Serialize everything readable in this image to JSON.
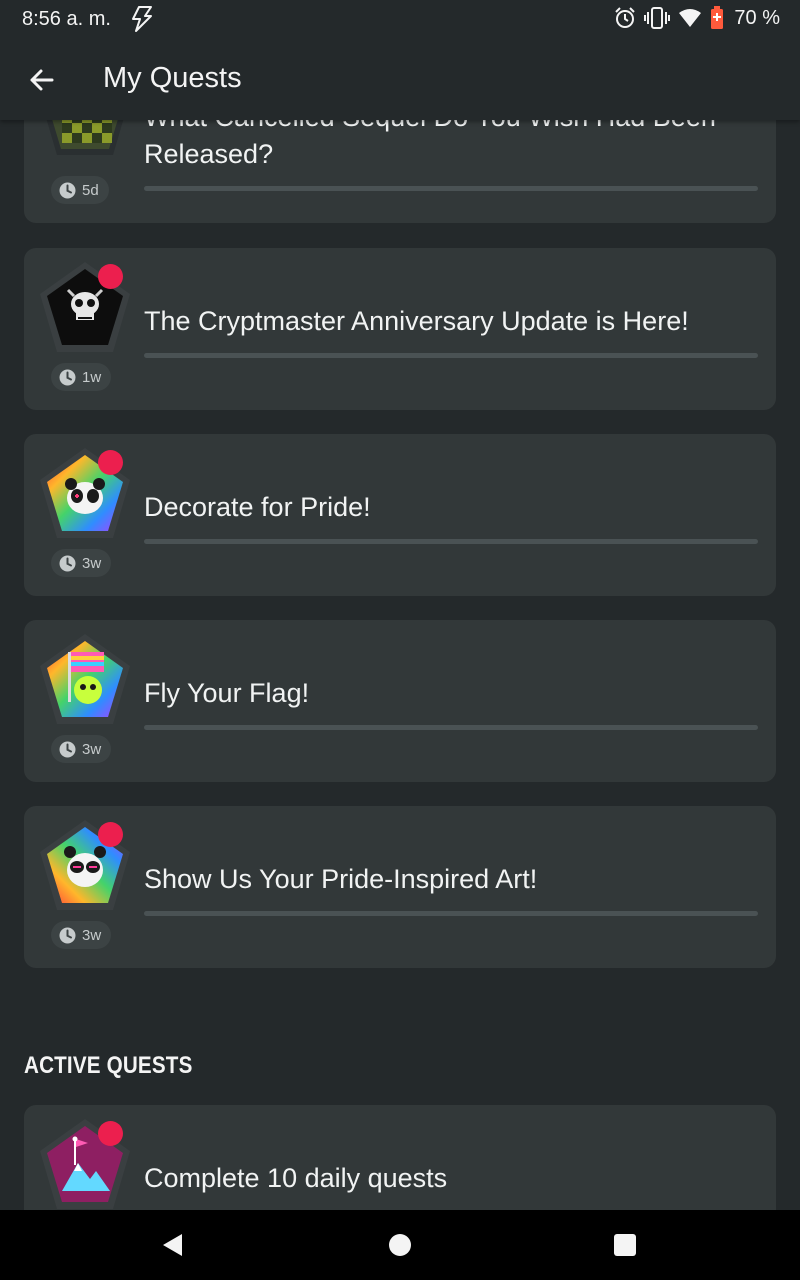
{
  "status_bar": {
    "time": "8:56 a. m.",
    "battery": "70 %",
    "icons": [
      "flash-icon",
      "alarm-icon",
      "vibrate-icon",
      "wifi-icon",
      "battery-icon"
    ]
  },
  "app_bar": {
    "title": "My Quests",
    "back_icon": "arrow-left-icon"
  },
  "quests": [
    {
      "title": "What Cancelled Sequel Do You Wish Had Been Released?",
      "time": "5d",
      "new": false
    },
    {
      "title": "The Cryptmaster Anniversary Update is Here!",
      "time": "1w",
      "new": true
    },
    {
      "title": "Decorate for Pride!",
      "time": "3w",
      "new": true
    },
    {
      "title": "Fly Your Flag!",
      "time": "3w",
      "new": false
    },
    {
      "title": "Show Us Your Pride-Inspired Art!",
      "time": "3w",
      "new": true
    }
  ],
  "active_section": {
    "heading": "ACTIVE QUESTS",
    "quests": [
      {
        "title": "Complete 10 daily quests",
        "new": true
      }
    ]
  },
  "colors": {
    "background": "#24292b",
    "card": "#323839",
    "notification_dot": "#ec1f4e",
    "progress_track": "#4a5254"
  },
  "nav_bar": {
    "icons": [
      "back-triangle-icon",
      "home-circle-icon",
      "recents-square-icon"
    ]
  }
}
